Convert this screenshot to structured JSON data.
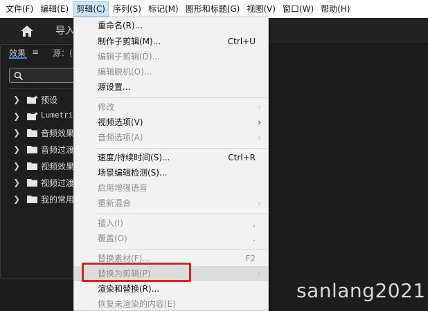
{
  "menubar": {
    "items": [
      {
        "label": "文件(F)"
      },
      {
        "label": "编辑(E)"
      },
      {
        "label": "剪辑(C)"
      },
      {
        "label": "序列(S)"
      },
      {
        "label": "标记(M)"
      },
      {
        "label": "图形和标题(G)"
      },
      {
        "label": "视图(V)"
      },
      {
        "label": "窗口(W)"
      },
      {
        "label": "帮助(H)"
      }
    ]
  },
  "topbar": {
    "tab": "导入"
  },
  "panel": {
    "tab_effects": "效果",
    "menu_glyph": "≡",
    "tab_source": "源：(",
    "tree": [
      {
        "label": "预设",
        "icon": "preset-folder-icon"
      },
      {
        "label": "Lumetri",
        "icon": "preset-folder-icon"
      },
      {
        "label": "音频效果",
        "icon": "folder-icon"
      },
      {
        "label": "音频过渡",
        "icon": "folder-icon"
      },
      {
        "label": "视频效果",
        "icon": "folder-icon"
      },
      {
        "label": "视频过渡",
        "icon": "folder-icon"
      },
      {
        "label": "我的常用",
        "icon": "folder-icon"
      }
    ]
  },
  "clip_menu": {
    "items": [
      {
        "label": "重命名(R)...",
        "shortcut": "",
        "enabled": true
      },
      {
        "label": "制作子剪辑(M)...",
        "shortcut": "Ctrl+U",
        "enabled": true
      },
      {
        "label": "编辑子剪辑(D)...",
        "shortcut": "",
        "enabled": false
      },
      {
        "label": "编辑脱机(O)...",
        "shortcut": "",
        "enabled": false
      },
      {
        "label": "源设置...",
        "shortcut": "",
        "enabled": true
      },
      {
        "label": "修改",
        "shortcut": "",
        "enabled": false,
        "submenu": true
      },
      {
        "label": "视频选项(V)",
        "shortcut": "",
        "enabled": true,
        "submenu": true
      },
      {
        "label": "音频选项(A)",
        "shortcut": "",
        "enabled": false,
        "submenu": true
      },
      {
        "label": "速度/持续时间(S)...",
        "shortcut": "Ctrl+R",
        "enabled": true
      },
      {
        "label": "场景编辑检测(S)...",
        "shortcut": "",
        "enabled": true
      },
      {
        "label": "启用增强语音",
        "shortcut": "",
        "enabled": false
      },
      {
        "label": "重新混合",
        "shortcut": "",
        "enabled": false,
        "submenu": true
      },
      {
        "label": "插入(I)",
        "shortcut": ",",
        "enabled": false
      },
      {
        "label": "覆盖(O)",
        "shortcut": ".",
        "enabled": false
      },
      {
        "label": "替换素材(F)...",
        "shortcut": "F2",
        "enabled": false
      },
      {
        "label": "替换为剪辑(P)",
        "shortcut": "",
        "enabled": false,
        "submenu": true,
        "highlighted": true
      },
      {
        "label": "渲染和替换(R)...",
        "shortcut": "",
        "enabled": true
      },
      {
        "label": "恢复未渲染的内容(E)",
        "shortcut": "",
        "enabled": false
      }
    ],
    "submenu_glyph": "›"
  },
  "watermark": "sanlang2021",
  "colors": {
    "highlight_box": "#e02020",
    "menu_active": "#cce4f7",
    "tab_underline": "#3d8dfd"
  }
}
